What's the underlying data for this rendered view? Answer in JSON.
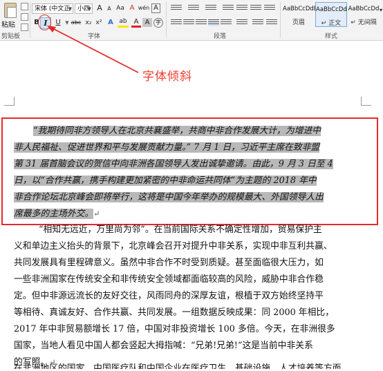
{
  "ribbon": {
    "paste_label": "粘贴",
    "clipboard_group": "剪贴板",
    "font_group": "字体",
    "paragraph_group": "段落",
    "styles_group": "样式",
    "font_name": "宋体 (中文正",
    "font_size": "小四",
    "grow_font_glyph": "A",
    "shrink_font_glyph": "A",
    "case_glyph": "Aa",
    "clear_format_glyph": "A",
    "wen_glyph": "wén",
    "char_border_glyph": "A",
    "bold_label": "B",
    "italic_label": "I",
    "underline_label": "U",
    "strike_label": "abc",
    "subscript_label": "x₂",
    "superscript_label": "x²",
    "text_effect_glyph": "A",
    "highlight_glyph": "ab",
    "font_color_glyph": "A",
    "char_shading_glyph": "A",
    "enclose_glyph": "字",
    "styles": [
      {
        "sample": "AaBbCcDdE",
        "name": "页眉"
      },
      {
        "sample": "AaBbCcDd",
        "name": "↵ 正文"
      },
      {
        "sample": "AaBbCcDd",
        "name": "↵ 无间隔"
      }
    ]
  },
  "annotation": {
    "text": "字体倾斜",
    "color": "#ef3b2d"
  },
  "document": {
    "quote_lines": [
      "“我期待同非方领导人在北京共襄盛举，共商中非合作发展大计，为增进中",
      "非人民福祉、促进世界和平与发展贡献力量。” 7 月 1 日，习近平主席在致非盟",
      "第 31 届首脑会议的贺信中向非洲各国领导人发出诚挚邀请。由此，9 月 3 日至 4",
      "日，以“合作共赢，携手构建更加紧密的中非命运共同体”为主题的 2018 年中",
      "非合作论坛北京峰会即将举行，这将是中国今年举办的规模最大、外国领导人出",
      "席最多的主场外交。"
    ],
    "body_lines": [
      "“相知无远近，万里尚为邻”。在当前国际关系不确定性增加，贸易保护主",
      "义和单边主义抬头的背景下，北京峰会召开对提升中非关系，实现中非互利共赢、",
      "共同发展具有里程碑意义。虽然中非合作不时受到质疑。甚至面临很大压力，如",
      "一些非洲国家在传统安全和非传统安全领域都面临较高的风险，威胁中非合作稳",
      "定。但中非源远流长的友好交往，风雨同舟的深厚友谊，根植于双方始终坚持平",
      "等相待、真诚友好、合作共赢、共同发展。一组数据反映成果：同 2000 年相比，",
      "2017 年中非贸易额增长 17 倍，中国对非投资增长 100 多倍。今天，在非洲很多",
      "国家，当地人看见中国人都会竖起大拇指喊：“兄弟!兄弟!”这是当前中非关系",
      "的写照。"
    ],
    "last_line": "  在非洲地区的国家，中国医疗队和中国企业在医疗卫生、基础设施、人才培养等方面"
  }
}
